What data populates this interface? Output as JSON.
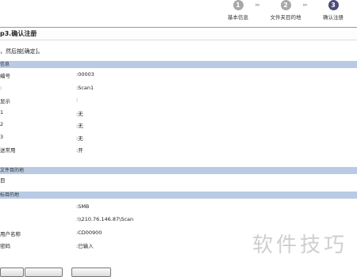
{
  "steps": [
    {
      "num": "1",
      "label": "基本信息",
      "active": false
    },
    {
      "num": "2",
      "label": "文件夹目的地",
      "active": false
    },
    {
      "num": "3",
      "label": "确认注册",
      "active": true
    }
  ],
  "step_arrow": "▸▸",
  "page_title": "p3.确认注册",
  "hint": "，然后按[确定]。",
  "sections": {
    "basic": "信息",
    "folder_dest": "文件目的地",
    "target": "标目的地"
  },
  "basic_rows": [
    {
      "key": "编号",
      "value": ":00003"
    },
    {
      "key": ":",
      "value": ":Scan1"
    },
    {
      "key": "显示",
      "value": ":"
    },
    {
      "key": "1",
      "value": ":无"
    },
    {
      "key": "2",
      "value": ":无"
    },
    {
      "key": "3",
      "value": ":无"
    },
    {
      "key": "送常用",
      "value": ":开"
    }
  ],
  "folder_row": "目",
  "target_rows": [
    {
      "key": "",
      "value": ":SMB"
    },
    {
      "key": "",
      "value": ":\\\\210.76.146.87\\Scan"
    },
    {
      "key": "用户名称",
      "value": ":CD00900"
    },
    {
      "key": "密码",
      "value": ":已输入"
    }
  ],
  "watermark": "软件技巧"
}
